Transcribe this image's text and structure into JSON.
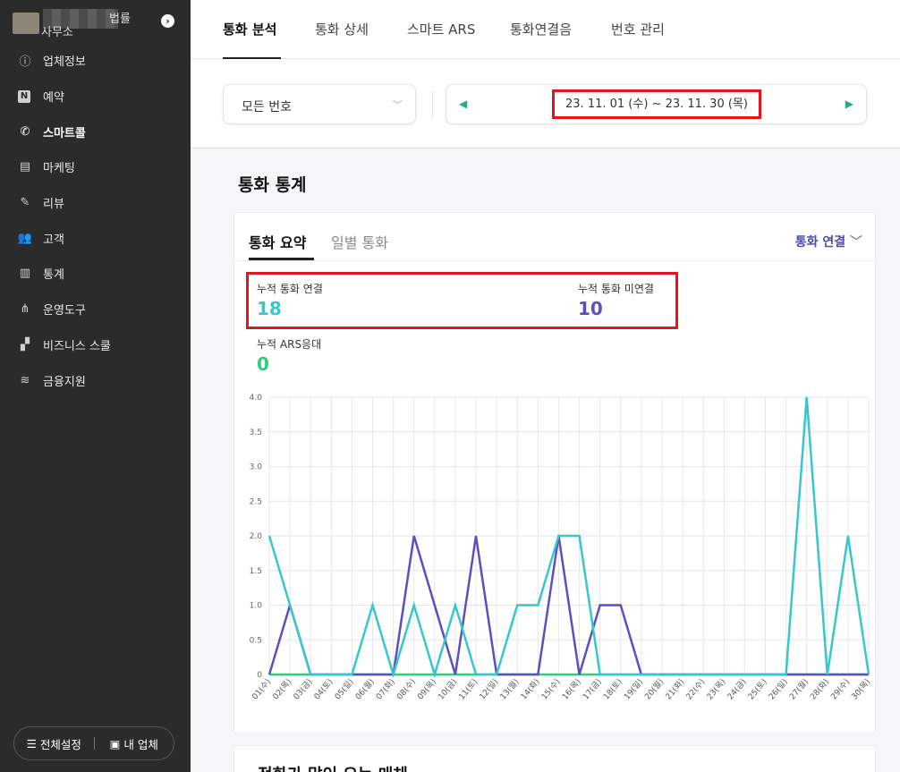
{
  "sidebar": {
    "brand": {
      "name_line1": "법률",
      "name_line2": "사무소"
    },
    "items": [
      {
        "label": "업체정보",
        "icon": "info-icon"
      },
      {
        "label": "예약",
        "icon": "naver-n-icon"
      },
      {
        "label": "스마트콜",
        "icon": "phone-icon",
        "active": true
      },
      {
        "label": "마케팅",
        "icon": "marketing-icon"
      },
      {
        "label": "리뷰",
        "icon": "pencil-icon"
      },
      {
        "label": "고객",
        "icon": "users-icon"
      },
      {
        "label": "통계",
        "icon": "stats-icon"
      },
      {
        "label": "운영도구",
        "icon": "share-icon"
      },
      {
        "label": "비즈니스 스쿨",
        "icon": "steps-icon"
      },
      {
        "label": "금융지원",
        "icon": "coins-icon"
      }
    ],
    "bottom": {
      "settings_label": "전체설정",
      "business_label": "내 업체"
    }
  },
  "tabs": [
    "통화 분석",
    "통화 상세",
    "스마트 ARS",
    "통화연결음",
    "번호 관리"
  ],
  "filter": {
    "number_select": "모든 번호",
    "date_range": "23. 11. 01 (수) ~ 23. 11. 30 (목)"
  },
  "section_title": "통화 통계",
  "card": {
    "subtabs": [
      "통화 요약",
      "일별 통화"
    ],
    "dropdown": "통화 연결",
    "stats": [
      {
        "label": "누적 통화 연결",
        "value": "18",
        "color": "#36c7cf"
      },
      {
        "label": "누적 통화 미연결",
        "value": "10",
        "color": "#5d4fbf"
      },
      {
        "label": "누적 ARS응대",
        "value": "0",
        "color": "#2ecf7a"
      }
    ]
  },
  "chart_data": {
    "type": "line",
    "categories": [
      "01(수)",
      "02(목)",
      "03(금)",
      "04(토)",
      "05(일)",
      "06(월)",
      "07(화)",
      "08(수)",
      "09(목)",
      "10(금)",
      "11(토)",
      "12(일)",
      "13(월)",
      "14(화)",
      "15(수)",
      "16(목)",
      "17(금)",
      "18(토)",
      "19(일)",
      "20(월)",
      "21(화)",
      "22(수)",
      "23(목)",
      "24(금)",
      "25(토)",
      "26(일)",
      "27(월)",
      "28(화)",
      "29(수)",
      "30(목)"
    ],
    "ylim": [
      0,
      4
    ],
    "yticks": [
      "0",
      "0.5",
      "1.0",
      "1.5",
      "2.0",
      "2.5",
      "3.0",
      "3.5",
      "4.0"
    ],
    "grid": true,
    "series": [
      {
        "color": "#2ecf7a",
        "values": [
          0,
          0,
          0,
          0,
          0,
          0,
          0,
          0,
          0,
          0,
          0,
          0,
          0,
          0,
          0,
          0,
          0,
          0,
          0,
          0,
          0,
          0,
          0,
          0,
          0,
          0,
          0,
          0,
          0,
          0
        ]
      },
      {
        "color": "#5d4fbf",
        "values": [
          0,
          1,
          0,
          0,
          0,
          0,
          0,
          2,
          1,
          0,
          2,
          0,
          0,
          0,
          2,
          0,
          1,
          1,
          0,
          0,
          0,
          0,
          0,
          0,
          0,
          0,
          0,
          0,
          0,
          0
        ]
      },
      {
        "color": "#36c7cf",
        "values": [
          2,
          1,
          0,
          0,
          0,
          1,
          0,
          1,
          0,
          1,
          0,
          0,
          1,
          1,
          2,
          2,
          0,
          0,
          0,
          0,
          0,
          0,
          0,
          0,
          0,
          0,
          4,
          0,
          2,
          0
        ]
      }
    ]
  },
  "bottom_card_title": "전화가 많이 오는 매체"
}
